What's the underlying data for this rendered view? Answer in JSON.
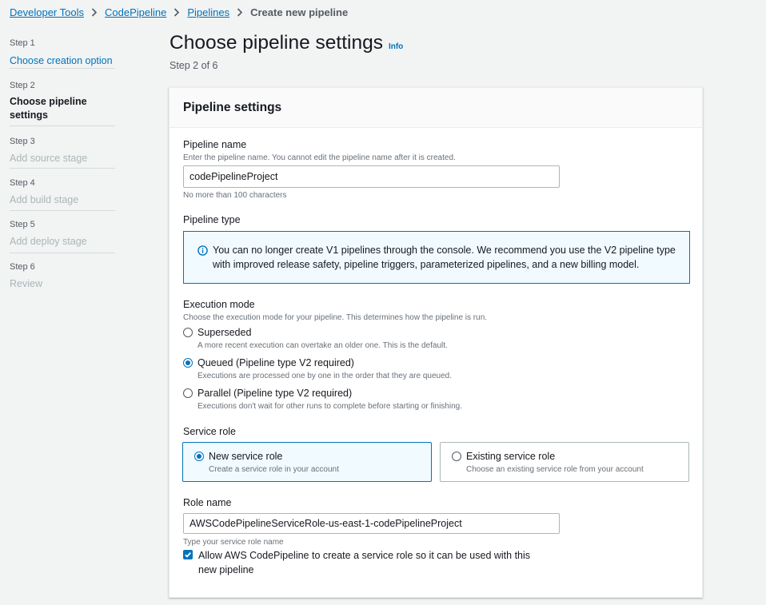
{
  "breadcrumb": {
    "items": [
      "Developer Tools",
      "CodePipeline",
      "Pipelines"
    ],
    "current": "Create new pipeline"
  },
  "steps": [
    {
      "num": "Step 1",
      "title": "Choose creation option",
      "state": "active"
    },
    {
      "num": "Step 2",
      "title": "Choose pipeline settings",
      "state": "current"
    },
    {
      "num": "Step 3",
      "title": "Add source stage",
      "state": "disabled"
    },
    {
      "num": "Step 4",
      "title": "Add build stage",
      "state": "disabled"
    },
    {
      "num": "Step 5",
      "title": "Add deploy stage",
      "state": "disabled"
    },
    {
      "num": "Step 6",
      "title": "Review",
      "state": "disabled"
    }
  ],
  "page": {
    "title": "Choose pipeline settings",
    "info": "Info",
    "step_of": "Step 2 of 6"
  },
  "panel": {
    "title": "Pipeline settings",
    "pipeline_name": {
      "label": "Pipeline name",
      "description": "Enter the pipeline name. You cannot edit the pipeline name after it is created.",
      "value": "codePipelineProject",
      "constraint": "No more than 100 characters"
    },
    "pipeline_type": {
      "label": "Pipeline type",
      "alert": "You can no longer create V1 pipelines through the console. We recommend you use the V2 pipeline type with improved release safety, pipeline triggers, parameterized pipelines, and a new billing model.",
      "alert_icon": "info-circle-icon"
    },
    "execution_mode": {
      "label": "Execution mode",
      "description": "Choose the execution mode for your pipeline. This determines how the pipeline is run.",
      "options": [
        {
          "label": "Superseded",
          "description": "A more recent execution can overtake an older one. This is the default.",
          "checked": false
        },
        {
          "label": "Queued (Pipeline type V2 required)",
          "description": "Executions are processed one by one in the order that they are queued.",
          "checked": true
        },
        {
          "label": "Parallel (Pipeline type V2 required)",
          "description": "Executions don't wait for other runs to complete before starting or finishing.",
          "checked": false
        }
      ]
    },
    "service_role": {
      "label": "Service role",
      "options": [
        {
          "label": "New service role",
          "description": "Create a service role in your account",
          "checked": true
        },
        {
          "label": "Existing service role",
          "description": "Choose an existing service role from your account",
          "checked": false
        }
      ]
    },
    "role_name": {
      "label": "Role name",
      "value": "AWSCodePipelineServiceRole-us-east-1-codePipelineProject",
      "constraint": "Type your service role name"
    },
    "allow_checkbox": {
      "label": "Allow AWS CodePipeline to create a service role so it can be used with this new pipeline",
      "checked": true
    }
  },
  "colors": {
    "link": "#0073bb",
    "background": "#f2f3f3",
    "alert_bg": "#f1faff"
  }
}
